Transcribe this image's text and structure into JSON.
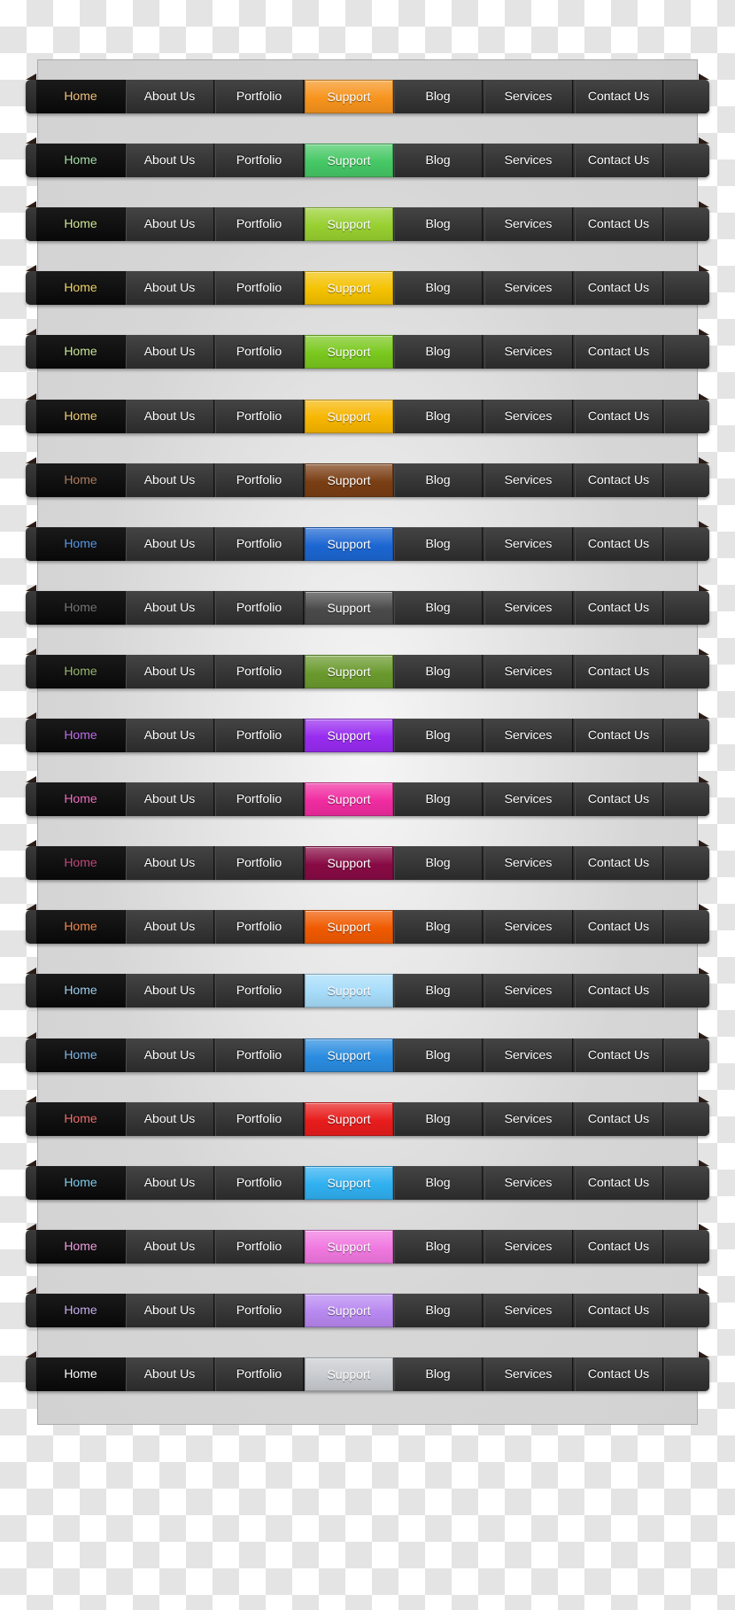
{
  "nav_items": [
    "Home",
    "About Us",
    "Portfolio",
    "Support",
    "Blog",
    "Services",
    "Contact Us"
  ],
  "active_item": "Support",
  "variants": [
    {
      "accent": "#f7941d",
      "home_color": "#f3c27e"
    },
    {
      "accent": "#46c865",
      "home_color": "#a6dfa8"
    },
    {
      "accent": "#98d030",
      "home_color": "#d5e898"
    },
    {
      "accent": "#f4c200",
      "home_color": "#f2d86a"
    },
    {
      "accent": "#7ac81e",
      "home_color": "#cce698"
    },
    {
      "accent": "#f7b600",
      "home_color": "#f0cf78"
    },
    {
      "accent": "#7a3e14",
      "home_color": "#b08060"
    },
    {
      "accent": "#1c66d2",
      "home_color": "#5a9ae8"
    },
    {
      "accent": "#4a4a4a",
      "home_color": "#777777"
    },
    {
      "accent": "#6a9a2e",
      "home_color": "#9ab870"
    },
    {
      "accent": "#982cf0",
      "home_color": "#c070f0"
    },
    {
      "accent": "#f02ca0",
      "home_color": "#f070c0"
    },
    {
      "accent": "#880a44",
      "home_color": "#c04a7a"
    },
    {
      "accent": "#f05a00",
      "home_color": "#f08a50"
    },
    {
      "accent": "#a6dcfa",
      "home_color": "#a0d0f0"
    },
    {
      "accent": "#2a8ce0",
      "home_color": "#80b8e8"
    },
    {
      "accent": "#e81c1c",
      "home_color": "#f07070"
    },
    {
      "accent": "#30b0f0",
      "home_color": "#80d0f0"
    },
    {
      "accent": "#f078e0",
      "home_color": "#f0a0e0"
    },
    {
      "accent": "#b888f0",
      "home_color": "#c8b0f0"
    },
    {
      "accent": "#c8ccd0",
      "home_color": "#ffffff"
    }
  ]
}
